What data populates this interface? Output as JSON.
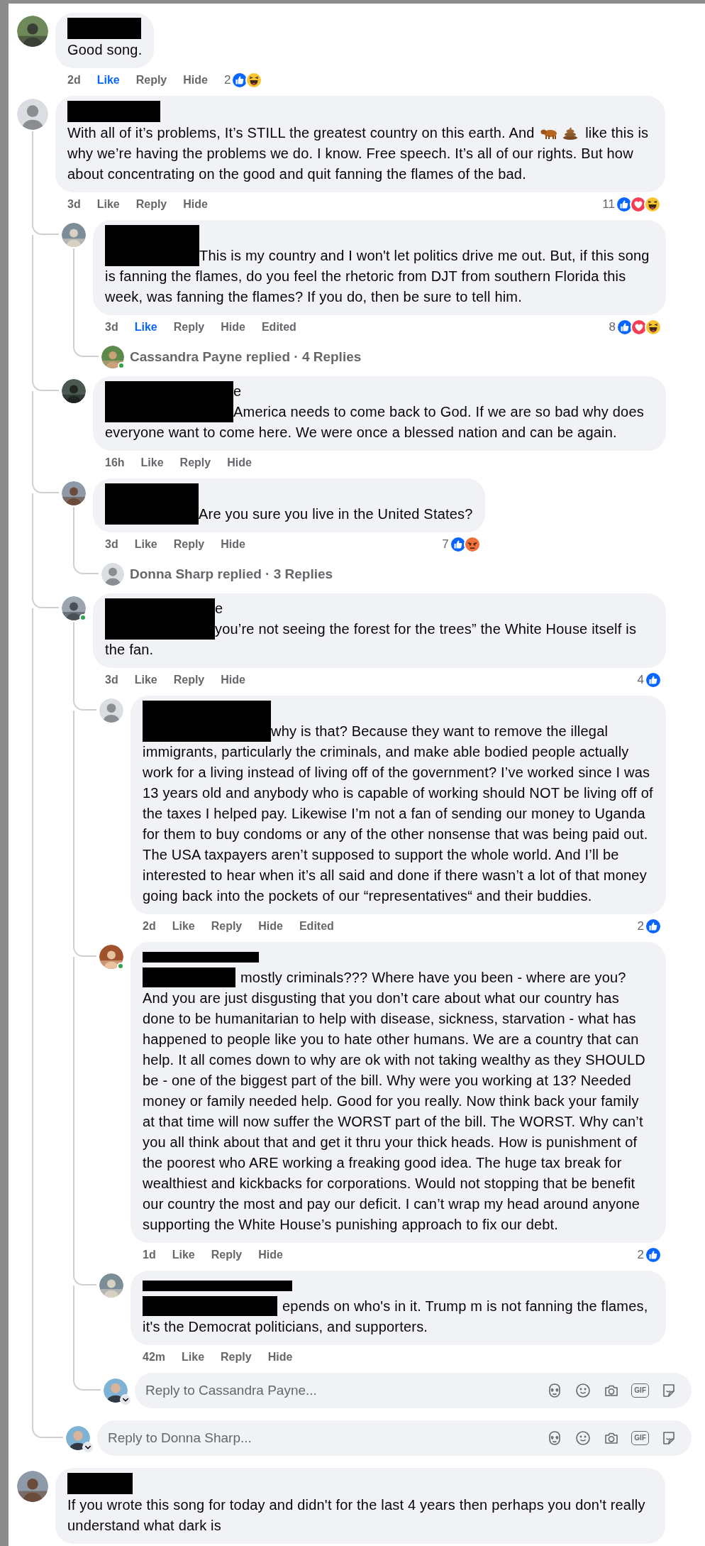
{
  "comments": [
    {
      "kind": "comment",
      "avatar": {
        "kind": "photo"
      },
      "online": false,
      "redaction": {
        "kind": "name"
      },
      "text": "Good song.",
      "time": "2d",
      "like": {
        "label": "Like",
        "on": true
      },
      "reply": "Reply",
      "hide": "Hide",
      "reactions": {
        "count": "2",
        "icons": [
          {
            "kind": "like"
          },
          {
            "kind": "haha"
          }
        ]
      }
    },
    {
      "kind": "comment",
      "avatar": {
        "kind": "default"
      },
      "online": false,
      "redaction": {
        "kind": "name"
      },
      "parts": [
        {
          "kind": "text",
          "text": "With all of it’s problems, It’s STILL the greatest country on this earth. And "
        },
        {
          "kind": "ox_emoji"
        },
        {
          "kind": "poop_emoji"
        },
        {
          "kind": "text",
          "text": " like this is why we’re having the problems we do. I know. Free speech. It’s all of our rights. But how about concentrating on the good and quit fanning the flames of the bad."
        }
      ],
      "time": "3d",
      "like": {
        "label": "Like",
        "on": false
      },
      "reply": "Reply",
      "hide": "Hide",
      "reactions": {
        "count": "11",
        "icons": [
          {
            "kind": "like"
          },
          {
            "kind": "love"
          },
          {
            "kind": "haha"
          }
        ]
      },
      "children": [
        {
          "kind": "comment",
          "avatar": {
            "kind": "photo"
          },
          "online": false,
          "redaction": {
            "kind": "overlap"
          },
          "text": "This is my country and I won't let politics drive me out. But, if this song is fanning the flames, do you feel the rhetoric from DJT from southern Florida this week, was fanning the flames? If you do, then be sure to tell him.",
          "time": "3d",
          "like": {
            "label": "Like",
            "on": true
          },
          "reply": "Reply",
          "hide": "Hide",
          "edited": "Edited",
          "reactions": {
            "count": "8",
            "icons": [
              {
                "kind": "like"
              },
              {
                "kind": "love"
              },
              {
                "kind": "haha"
              }
            ]
          },
          "children": [
            {
              "kind": "replies_summary",
              "avatar": {
                "kind": "photo"
              },
              "online": true,
              "text": "Cassandra Payne replied · 4 Replies"
            }
          ]
        },
        {
          "kind": "comment",
          "avatar": {
            "kind": "photo"
          },
          "online": false,
          "redaction": {
            "kind": "overlap"
          },
          "name_fragment": "e",
          "text": "America needs to come back to God. If we are so bad why does everyone want to come here. We were once a blessed nation and can be again.",
          "time": "16h",
          "like": {
            "label": "Like",
            "on": false
          },
          "reply": "Reply",
          "hide": "Hide"
        },
        {
          "kind": "comment",
          "avatar": {
            "kind": "photo"
          },
          "online": false,
          "redaction": {
            "kind": "overlap"
          },
          "text": "Are you sure you live in the United States?",
          "time": "3d",
          "like": {
            "label": "Like",
            "on": false
          },
          "reply": "Reply",
          "hide": "Hide",
          "reactions": {
            "count": "7",
            "icons": [
              {
                "kind": "like"
              },
              {
                "kind": "angry"
              }
            ]
          },
          "children": [
            {
              "kind": "replies_summary",
              "avatar": {
                "kind": "default"
              },
              "online": false,
              "text": "Donna Sharp replied · 3 Replies"
            }
          ]
        },
        {
          "kind": "comment",
          "avatar": {
            "kind": "photo"
          },
          "online": true,
          "redaction": {
            "kind": "overlap"
          },
          "name_fragment": "e",
          "text": "you’re not seeing the forest for the trees” the White House itself is the fan.",
          "time": "3d",
          "like": {
            "label": "Like",
            "on": false
          },
          "reply": "Reply",
          "hide": "Hide",
          "reactions": {
            "count": "4",
            "icons": [
              {
                "kind": "like"
              }
            ]
          },
          "children": [
            {
              "kind": "comment",
              "avatar": {
                "kind": "default"
              },
              "online": false,
              "redaction": {
                "kind": "overlap"
              },
              "text": "why is that? Because they want to remove the illegal immigrants, particularly the criminals, and make able bodied people actually work for a living instead of living off of the government? I’ve worked since I was 13 years old and anybody who is capable of working should NOT be living off of the taxes I helped pay. Likewise I’m not a fan of sending our money to Uganda for them to buy condoms or any of the other nonsense that was being paid out. The USA taxpayers aren’t supposed to support the whole world. And I’ll be interested to hear when it’s all said and done if there wasn’t a lot of that money going back into the pockets of our “representatives“ and their buddies.",
              "time": "2d",
              "like": {
                "label": "Like",
                "on": false
              },
              "reply": "Reply",
              "hide": "Hide",
              "edited": "Edited",
              "reactions": {
                "count": "2",
                "icons": [
                  {
                    "kind": "like"
                  }
                ]
              }
            },
            {
              "kind": "comment",
              "avatar": {
                "kind": "photo"
              },
              "online": true,
              "redaction": {
                "kind": "split"
              },
              "text": "mostly criminals??? Where have you been - where are you? And you are just disgusting that you don’t care about what our country has done to be humanitarian to help with disease, sickness, starvation - what has happened to people like you to hate other humans. We are a country that can help. It all comes down to why are ok with not taking wealthy as they SHOULD be - one of the biggest part of the bill. Why were you working at 13? Needed money or family needed help. Good for you really. Now think back your family at that time will now suffer the WORST part of the bill. The WORST. Why can’t you all think about that and get it thru your thick heads. How is punishment of the poorest who ARE working a freaking good idea. The huge tax break for wealthiest and kickbacks for corporations. Would not stopping that be benefit our country the most and pay our deficit. I can’t wrap my head around anyone supporting the White House’s punishing approach to fix our debt.",
              "time": "1d",
              "like": {
                "label": "Like",
                "on": false
              },
              "reply": "Reply",
              "hide": "Hide",
              "reactions": {
                "count": "2",
                "icons": [
                  {
                    "kind": "like"
                  }
                ]
              }
            },
            {
              "kind": "comment",
              "avatar": {
                "kind": "photo"
              },
              "online": false,
              "redaction": {
                "kind": "split"
              },
              "text": "epends on who's in it. Trump m is not fanning the flames, it's the Democrat politicians, and supporters.",
              "time": "42m",
              "like": {
                "label": "Like",
                "on": false
              },
              "reply": "Reply",
              "hide": "Hide"
            },
            {
              "kind": "composer",
              "placeholder": "Reply to Cassandra Payne...",
              "gif": "GIF"
            }
          ]
        },
        {
          "kind": "composer",
          "placeholder": "Reply to Donna Sharp...",
          "gif": "GIF"
        }
      ]
    },
    {
      "kind": "comment",
      "avatar": {
        "kind": "photo"
      },
      "online": false,
      "redaction": {
        "kind": "name"
      },
      "text": "If you wrote this song for today and didn't for the last 4 years then perhaps you don't really understand what dark is"
    }
  ]
}
